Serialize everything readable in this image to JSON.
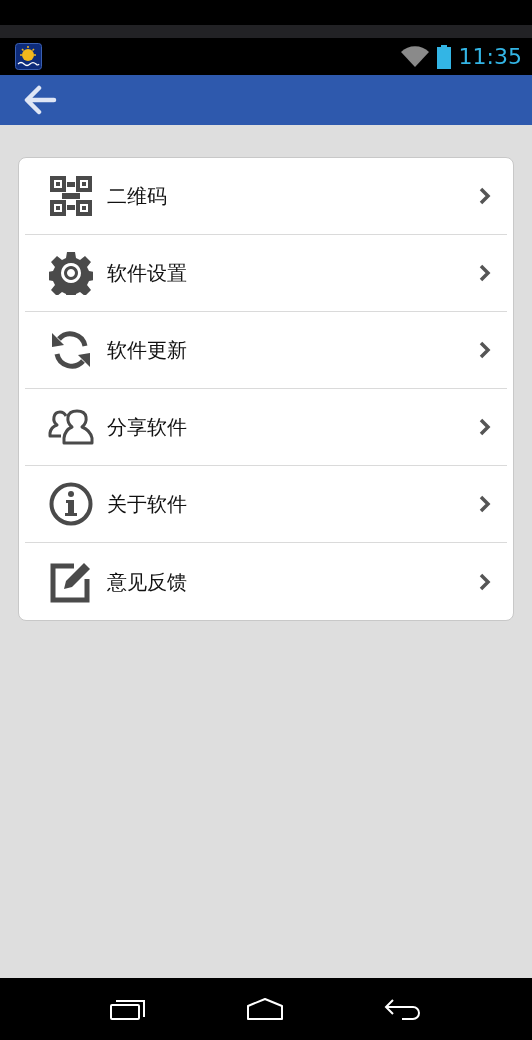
{
  "status_bar": {
    "time": "11:35"
  },
  "menu": [
    {
      "kind": "qrcode",
      "label": "二维码"
    },
    {
      "kind": "settings",
      "label": "软件设置"
    },
    {
      "kind": "update",
      "label": "软件更新"
    },
    {
      "kind": "share",
      "label": "分享软件"
    },
    {
      "kind": "about",
      "label": "关于软件"
    },
    {
      "kind": "feedback",
      "label": "意见反馈"
    }
  ]
}
